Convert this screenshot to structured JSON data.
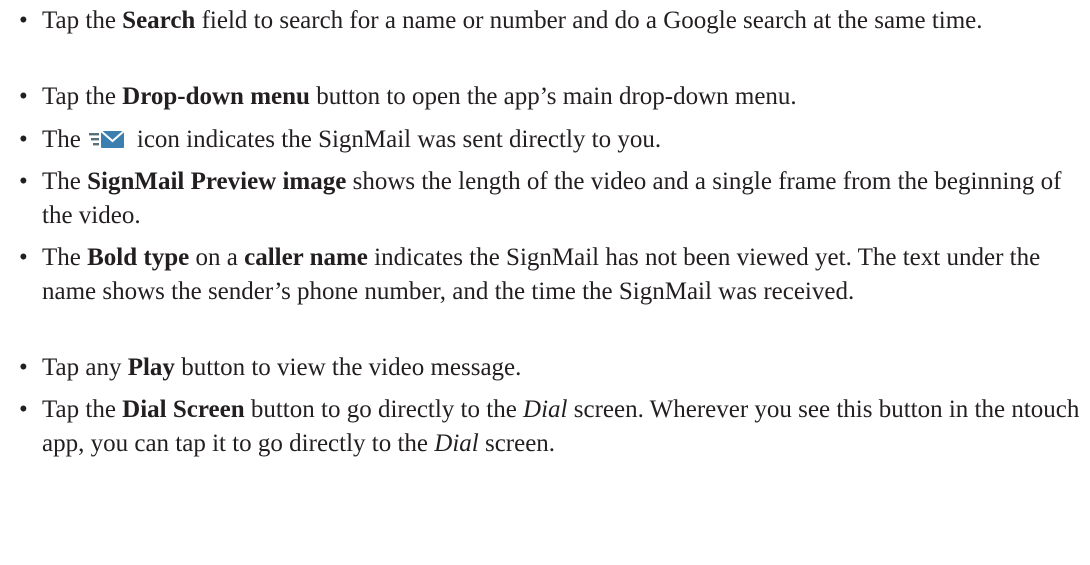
{
  "bullet_char": "•",
  "items": [
    {
      "p1": "Tap the ",
      "b1": "Search",
      "p2": " field to search for a name or number and do a Google search at the same time."
    },
    {
      "p1": "Tap the ",
      "b1": "Drop-down menu",
      "p2": " button to open the app’s main drop-down menu."
    },
    {
      "p1": "The",
      "icon": "signmail-sent-direct-icon",
      "p2": "icon indicates the SignMail was sent directly to you."
    },
    {
      "p1": "The ",
      "b1": "SignMail Preview image",
      "p2": " shows the length of the video and a single frame from the beginning of the video."
    },
    {
      "p1": "The ",
      "b1": "Bold type",
      "p2": " on a ",
      "b2": "caller name",
      "p3": " indicates the SignMail has not been viewed yet. The text under the name shows the sender’s phone number, and the time the SignMail was received."
    },
    {
      "p1": "Tap any ",
      "b1": "Play",
      "p2": " button to view the video message."
    },
    {
      "p1": "Tap the ",
      "b1": "Dial Screen",
      "p2": " button to go directly to the ",
      "i1": "Dial",
      "p3": " screen. Wherever you see this button in the ntouch app, you can tap it to go directly to the ",
      "i2": "Dial",
      "p4": " screen."
    }
  ],
  "colors": {
    "text": "#231f20",
    "icon_envelope": "#3a7fb0",
    "icon_lines": "#5a6f7c"
  }
}
